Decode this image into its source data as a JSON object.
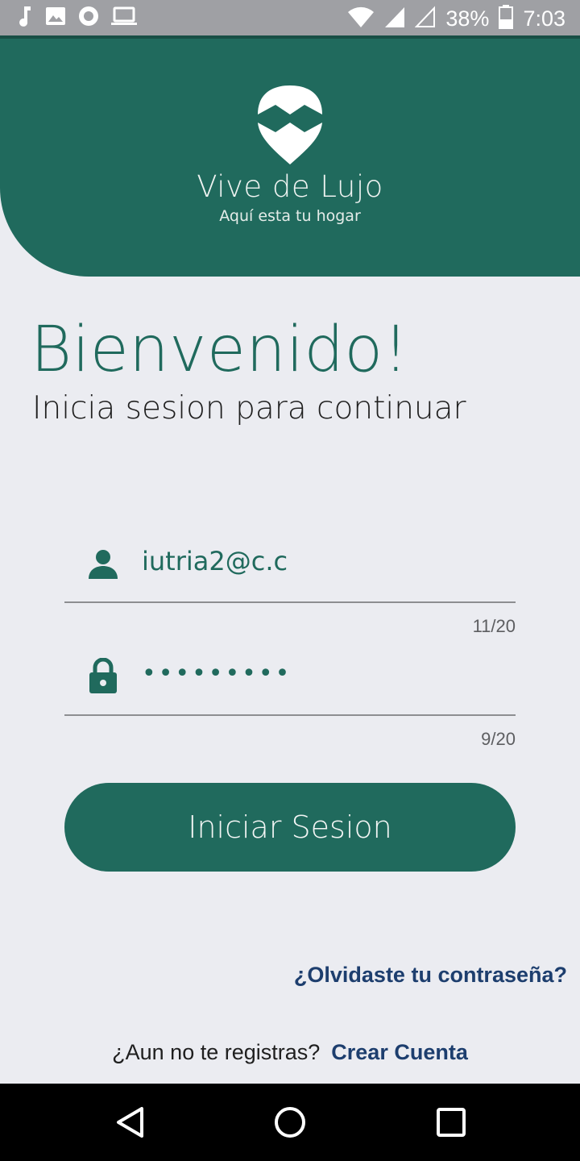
{
  "status_bar": {
    "icons_left": [
      "music-note-icon",
      "image-icon",
      "record-icon",
      "laptop-icon"
    ],
    "icons_right": [
      "wifi-icon",
      "signal-icon",
      "signal-empty-icon",
      "battery-icon"
    ],
    "battery": "38%",
    "time": "7:03"
  },
  "header": {
    "brand_name": "Vive de Lujo",
    "tagline": "Aquí esta tu hogar",
    "logo_icon": "home-pin-logo-icon",
    "color": "#206a5d"
  },
  "welcome": {
    "title": "Bienvenido!",
    "subtitle": "Inicia sesion para continuar"
  },
  "form": {
    "email": {
      "icon": "person-icon",
      "value": "iutria2@c.c",
      "counter": "11/20"
    },
    "password": {
      "icon": "lock-icon",
      "value": "•••••••••",
      "counter": "9/20"
    },
    "submit_label": "Iniciar Sesion"
  },
  "links": {
    "forgot_password": "¿Olvidaste tu contraseña?",
    "register_prompt": "¿Aun no te registras?",
    "create_account": "Crear Cuenta"
  },
  "nav_bar": {
    "buttons": [
      "back-icon",
      "home-icon",
      "recents-icon"
    ]
  },
  "colors": {
    "primary": "#206a5d",
    "link": "#1d3e6e",
    "background": "#ebecf1"
  }
}
